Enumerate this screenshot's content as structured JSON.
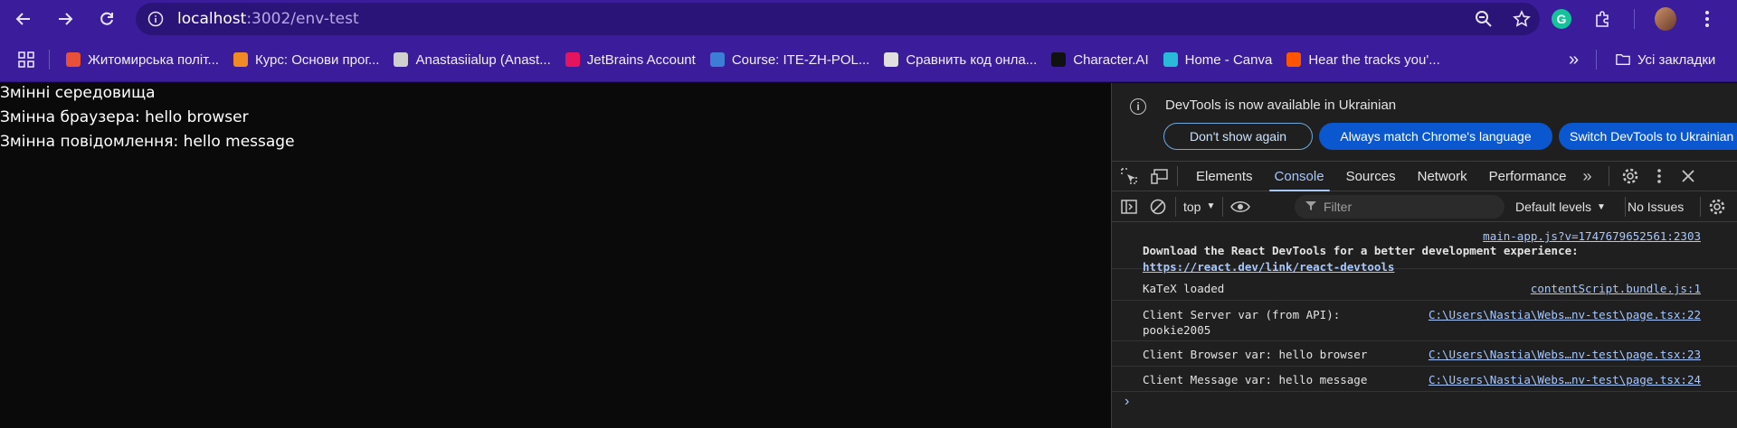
{
  "browser": {
    "url_host": "localhost",
    "url_rest": ":3002/env-test",
    "bookmarks": [
      {
        "label": "Житомирська політ...",
        "color": "#e8503a"
      },
      {
        "label": "Курс: Основи прог...",
        "color": "#f08a24"
      },
      {
        "label": "Anastasiialup (Anast...",
        "color": "#d0d0d0"
      },
      {
        "label": "JetBrains Account",
        "color": "#e6145f"
      },
      {
        "label": "Course: ITE-ZH-POL...",
        "color": "#3d7dd8"
      },
      {
        "label": "Сравнить код онла...",
        "color": "#e0e0e0"
      },
      {
        "label": "Character.AI",
        "color": "#111111"
      },
      {
        "label": "Home - Canva",
        "color": "#2bb9d9"
      },
      {
        "label": "Hear the tracks you'...",
        "color": "#ff5500"
      }
    ],
    "more_bookmarks": "»",
    "all_bookmarks": "Усі закладки"
  },
  "page": {
    "heading": "Змінні середовища",
    "browser_var": "Змінна браузера: hello browser",
    "message_var": "Змінна повідомлення: hello message"
  },
  "devtools": {
    "banner": {
      "message": "DevTools is now available in Ukrainian",
      "dont_show": "Don't show again",
      "always_match": "Always match Chrome's language",
      "switch": "Switch DevTools to Ukrainian"
    },
    "tabs": [
      "Elements",
      "Console",
      "Sources",
      "Network",
      "Performance"
    ],
    "active_tab": "Console",
    "toolbar": {
      "context": "top",
      "filter_placeholder": "Filter",
      "levels": "Default levels",
      "issues": "No Issues"
    },
    "logs": [
      {
        "source": "main-app.js?v=1747679652561:2303",
        "text": "Download the React DevTools for a better development experience:",
        "link": "https://react.dev/link/react-devtools"
      },
      {
        "text": "KaTeX loaded",
        "source": "contentScript.bundle.js:1"
      },
      {
        "text": "Client Server var (from API):",
        "text2": "pookie2005",
        "source": "C:\\Users\\Nastia\\Webs…nv-test\\page.tsx:22"
      },
      {
        "text": "Client Browser var: hello browser",
        "source": "C:\\Users\\Nastia\\Webs…nv-test\\page.tsx:23"
      },
      {
        "text": "Client Message var: hello message",
        "source": "C:\\Users\\Nastia\\Webs…nv-test\\page.tsx:24"
      }
    ],
    "prompt": "›"
  }
}
